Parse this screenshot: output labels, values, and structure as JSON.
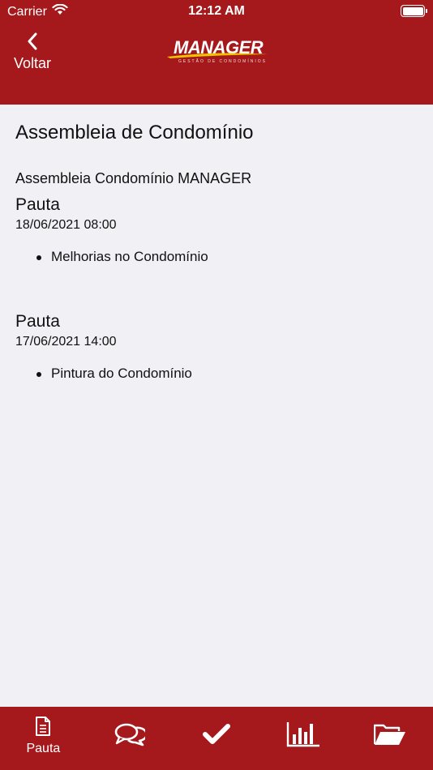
{
  "status_bar": {
    "carrier": "Carrier",
    "time": "12:12 AM"
  },
  "nav": {
    "back_label": "Voltar"
  },
  "logo": {
    "wordmark": "MANAGER",
    "tagline": "GESTÃO DE CONDOMÍNIOS"
  },
  "page": {
    "title": "Assembleia de Condomínio",
    "subtitle": "Assembleia Condomínio MANAGER"
  },
  "pautas": [
    {
      "title": "Pauta",
      "date": "18/06/2021 08:00",
      "items": [
        "Melhorias no Condomínio"
      ]
    },
    {
      "title": "Pauta",
      "date": "17/06/2021 14:00",
      "items": [
        "Pintura do Condomínio"
      ]
    }
  ],
  "tabs": [
    {
      "label": "Pauta",
      "icon": "document-icon"
    },
    {
      "label": "",
      "icon": "chat-bubbles-icon"
    },
    {
      "label": "",
      "icon": "checkmark-icon"
    },
    {
      "label": "",
      "icon": "bar-chart-icon"
    },
    {
      "label": "",
      "icon": "folder-open-icon"
    }
  ],
  "colors": {
    "brand": "#a5191c",
    "background": "#f0f0f5",
    "logo_accent": "#f2c200"
  }
}
